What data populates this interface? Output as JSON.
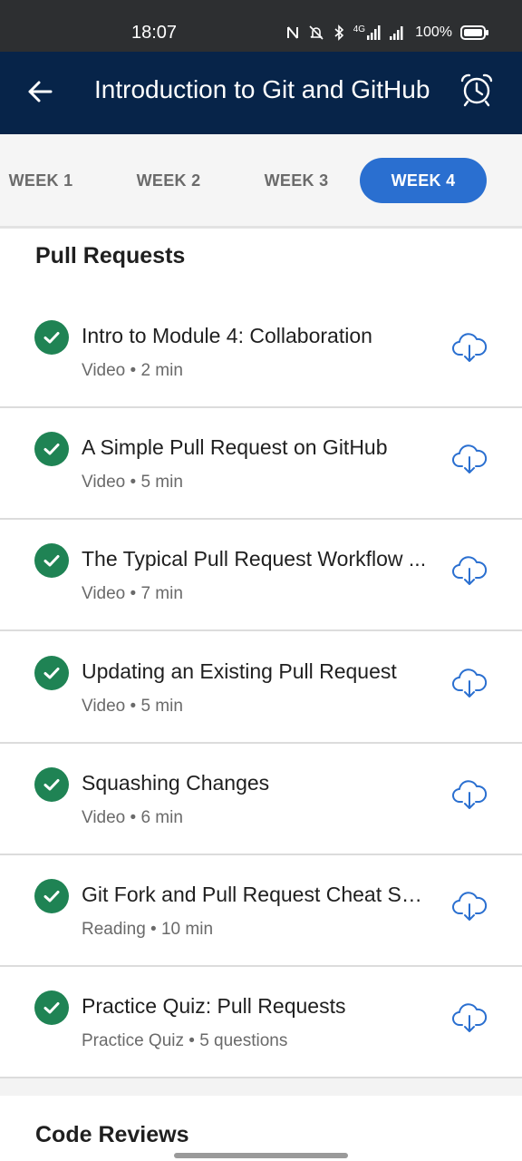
{
  "status_bar": {
    "time": "18:07",
    "network": "4G",
    "battery": "100%",
    "icons": [
      "nfc-icon",
      "mute-icon",
      "bluetooth-icon",
      "signal-4g-icon",
      "signal-icon",
      "battery-icon"
    ]
  },
  "app_bar": {
    "title": "Introduction to Git and GitHub",
    "back_icon": "arrow-left-icon",
    "alarm_icon": "alarm-clock-icon"
  },
  "tabs": [
    {
      "label": "WEEK 1",
      "active": false
    },
    {
      "label": "WEEK 2",
      "active": false
    },
    {
      "label": "WEEK 3",
      "active": false
    },
    {
      "label": "WEEK 4",
      "active": true
    }
  ],
  "sections": [
    {
      "title": "Pull Requests",
      "items": [
        {
          "title": "Intro to Module 4: Collaboration",
          "meta": "Video • 2 min",
          "completed": true
        },
        {
          "title": "A Simple Pull Request on GitHub",
          "meta": "Video • 5 min",
          "completed": true
        },
        {
          "title": "The Typical Pull Request Workflow ...",
          "meta": "Video • 7 min",
          "completed": true
        },
        {
          "title": "Updating an Existing Pull Request",
          "meta": "Video • 5 min",
          "completed": true
        },
        {
          "title": "Squashing Changes",
          "meta": "Video • 6 min",
          "completed": true
        },
        {
          "title": "Git Fork and Pull Request Cheat Sh...",
          "meta": "Reading • 10 min",
          "completed": true
        },
        {
          "title": "Practice Quiz: Pull Requests",
          "meta": "Practice Quiz • 5 questions",
          "completed": true
        }
      ]
    },
    {
      "title": "Code Reviews",
      "items": []
    }
  ],
  "colors": {
    "app_bar": "#072449",
    "status_bar": "#2d2f31",
    "accent": "#2a6fd0",
    "check": "#1f8354",
    "download_icon": "#2a6fd0"
  }
}
